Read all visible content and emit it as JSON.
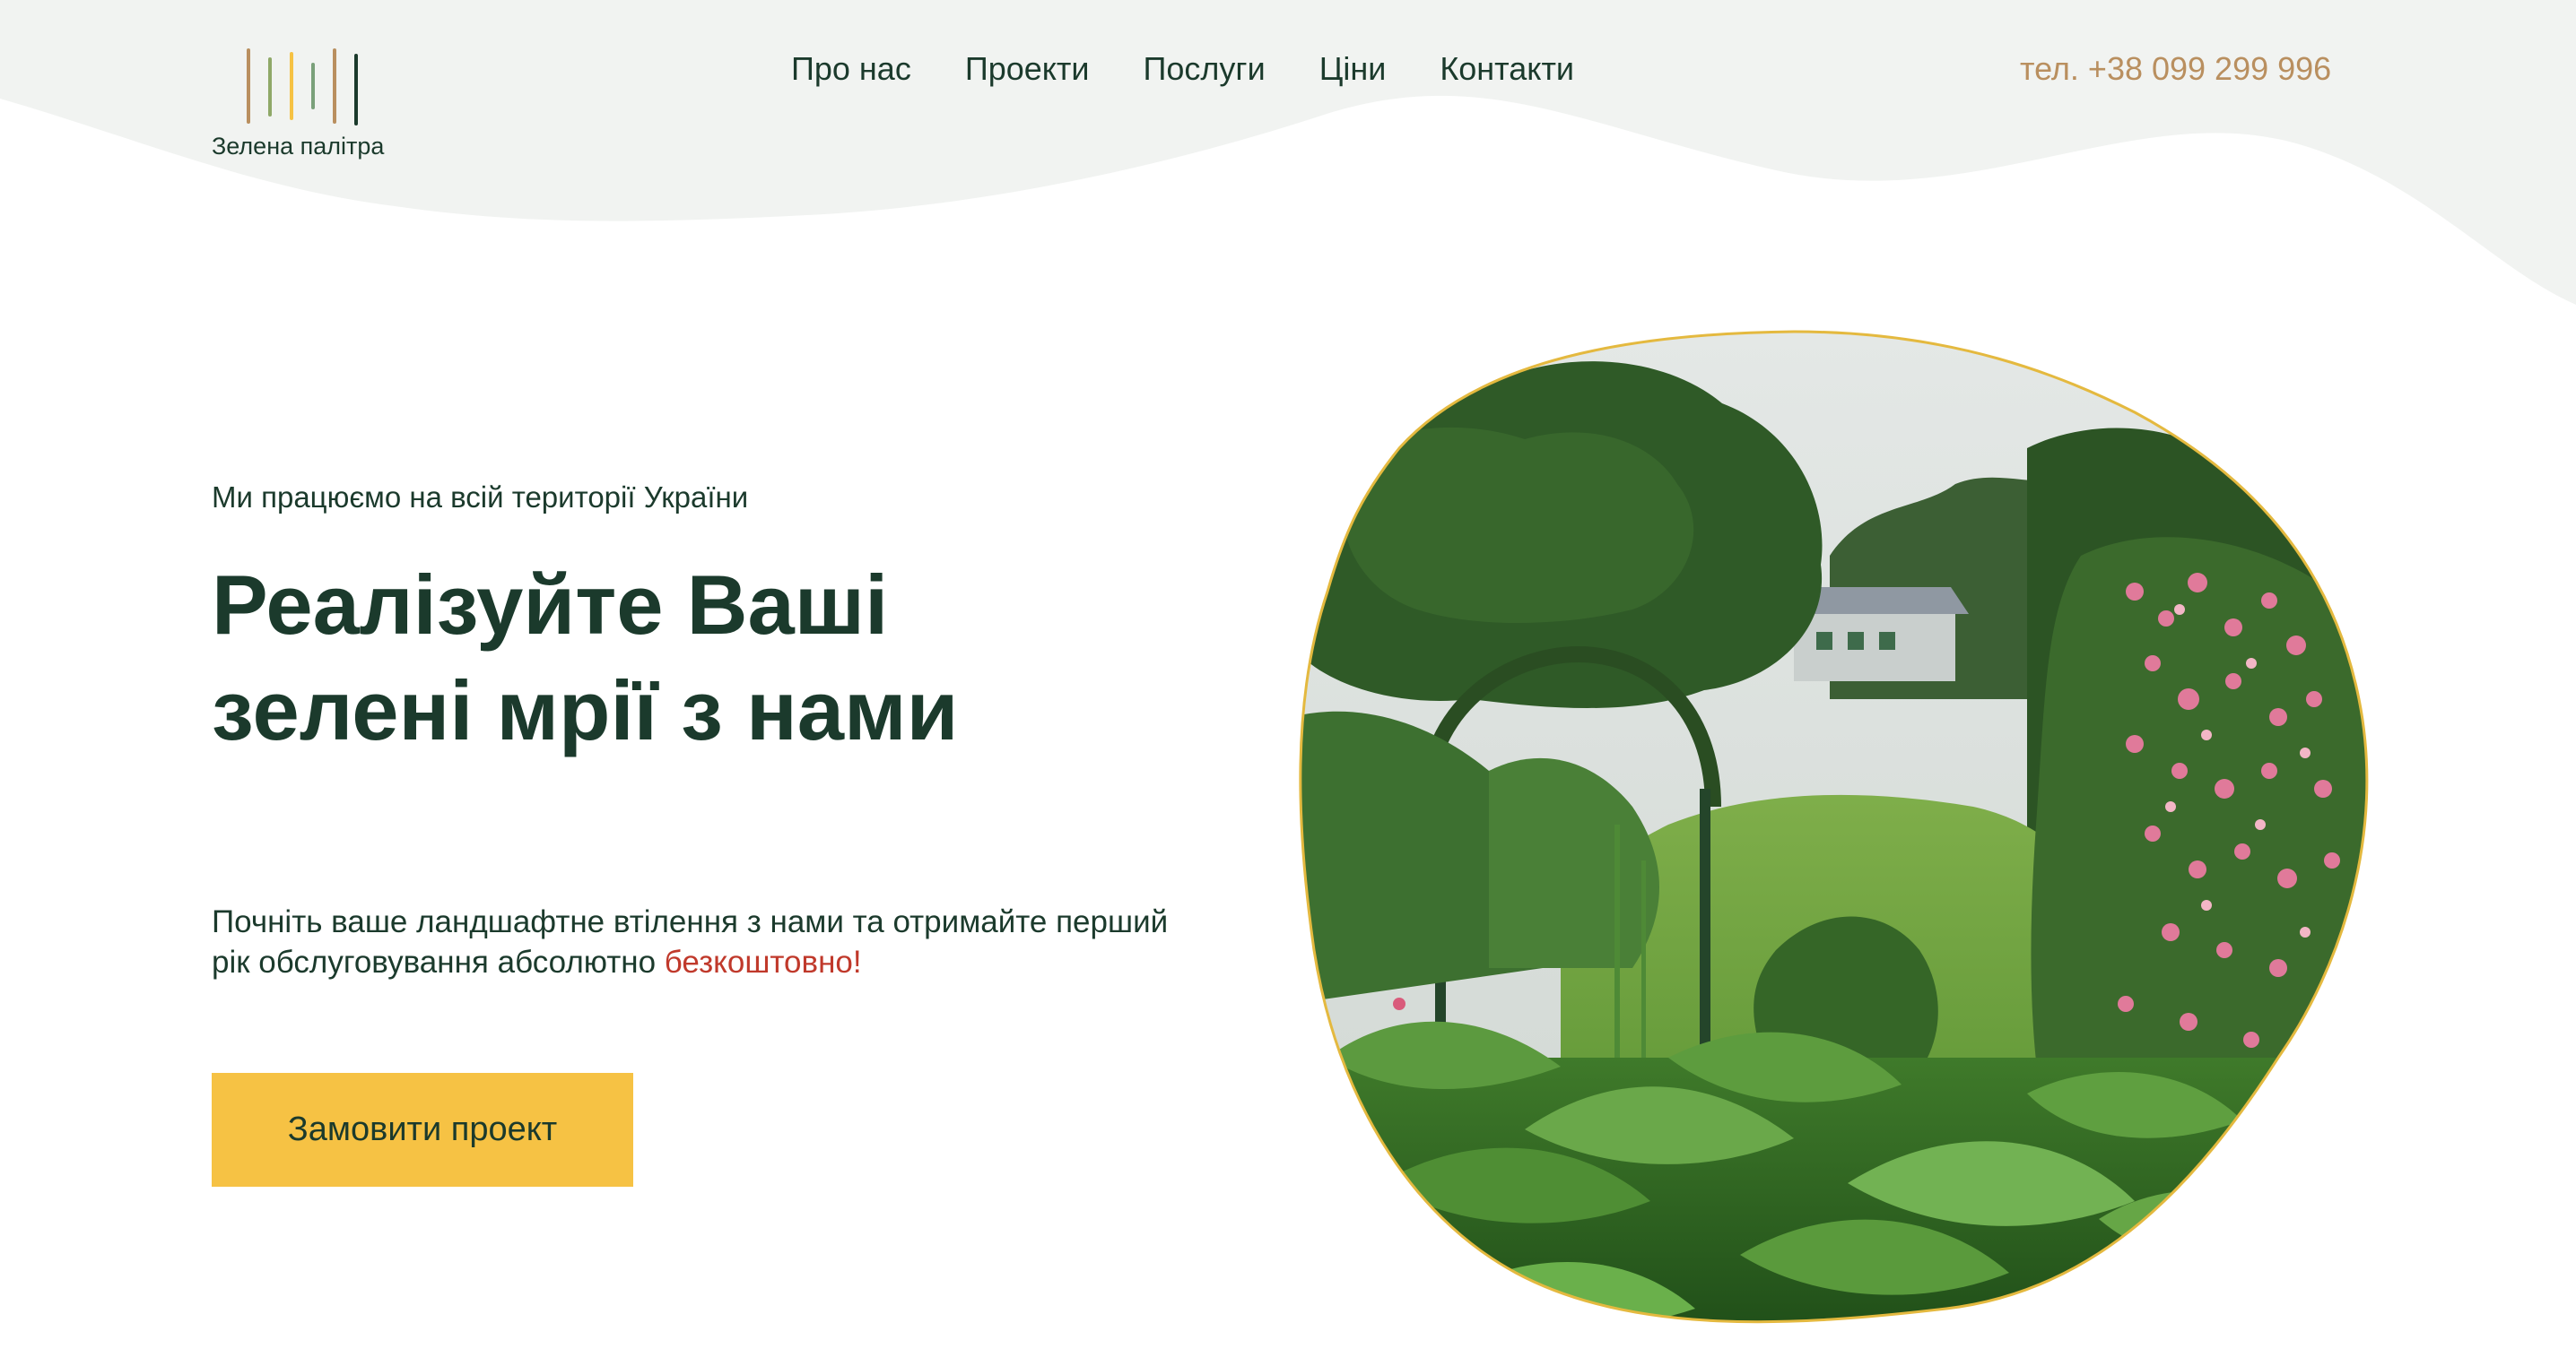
{
  "brand": {
    "name": "Зелена палітра",
    "bar_colors": [
      "#b98f5f",
      "#8fa868",
      "#f6c244",
      "#7aa07a",
      "#b98f5f",
      "#1b3a2c"
    ]
  },
  "nav": {
    "items": [
      {
        "label": "Про нас"
      },
      {
        "label": "Проекти"
      },
      {
        "label": "Послуги"
      },
      {
        "label": "Ціни"
      },
      {
        "label": "Контакти"
      }
    ]
  },
  "header": {
    "phone": "тел. +38 099 299 996"
  },
  "hero": {
    "eyebrow": "Ми працюємо на всій території України",
    "title_line1": "Реалізуйте Ваші",
    "title_line2": "зелені мрії з нами",
    "text_main": "Почніть ваше ландшафтне втілення з нами та отримайте перший рік обслуговування абсолютно ",
    "text_accent": "безкоштовно!",
    "cta_label": "Замовити проект"
  },
  "colors": {
    "primary_dark": "#1b3a2c",
    "accent_yellow": "#f6c244",
    "phone_gold": "#b98f5f",
    "accent_red": "#c0392b",
    "wave_bg": "#f1f3f1"
  },
  "icons": {
    "logo": "vertical-bars-logo-icon",
    "garden_image": "garden-blob-image"
  }
}
